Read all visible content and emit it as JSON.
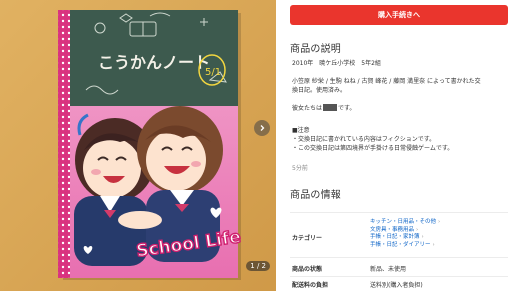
{
  "carousel": {
    "counter": "1 / 2",
    "next_icon": "chevron-right-icon"
  },
  "notebook": {
    "title": "こうかんノート",
    "logo": "School Life"
  },
  "buy_button": {
    "label": "購入手続きへ"
  },
  "description": {
    "heading": "商品の説明",
    "line1": "2010年　暁ケ丘小学校　5年2組",
    "line2a": "小笠原 紗栄 / 生駒 ねね / 古賀 峰花 / 藤岡 満里奈 によって書かれた交",
    "line2b": "換日記。使用済み。",
    "line3a": "彼女たちは",
    "line3b": "です。",
    "note_heading": "■注意",
    "note1": "・交換日記に書かれている内容はフィクションです。",
    "note2": "・この交換日記は第四境界が手掛ける日常侵蝕ゲームです。",
    "time": "5分前"
  },
  "item_info": {
    "heading": "商品の情報",
    "category_label": "カテゴリー",
    "categories": [
      "キッチン・日用品・その他",
      "文房具・事務用品",
      "手帳・日記・家計簿",
      "手帳・日記・ダイアリー"
    ],
    "condition_label": "商品の状態",
    "condition_value": "新品、未使用",
    "shipping_label": "配送料の負担",
    "shipping_value": "送料別(購入者負担)"
  },
  "colors": {
    "buy_button": "#ea352d",
    "link": "#0b63c7",
    "photo_bg": "#dcac5a"
  }
}
